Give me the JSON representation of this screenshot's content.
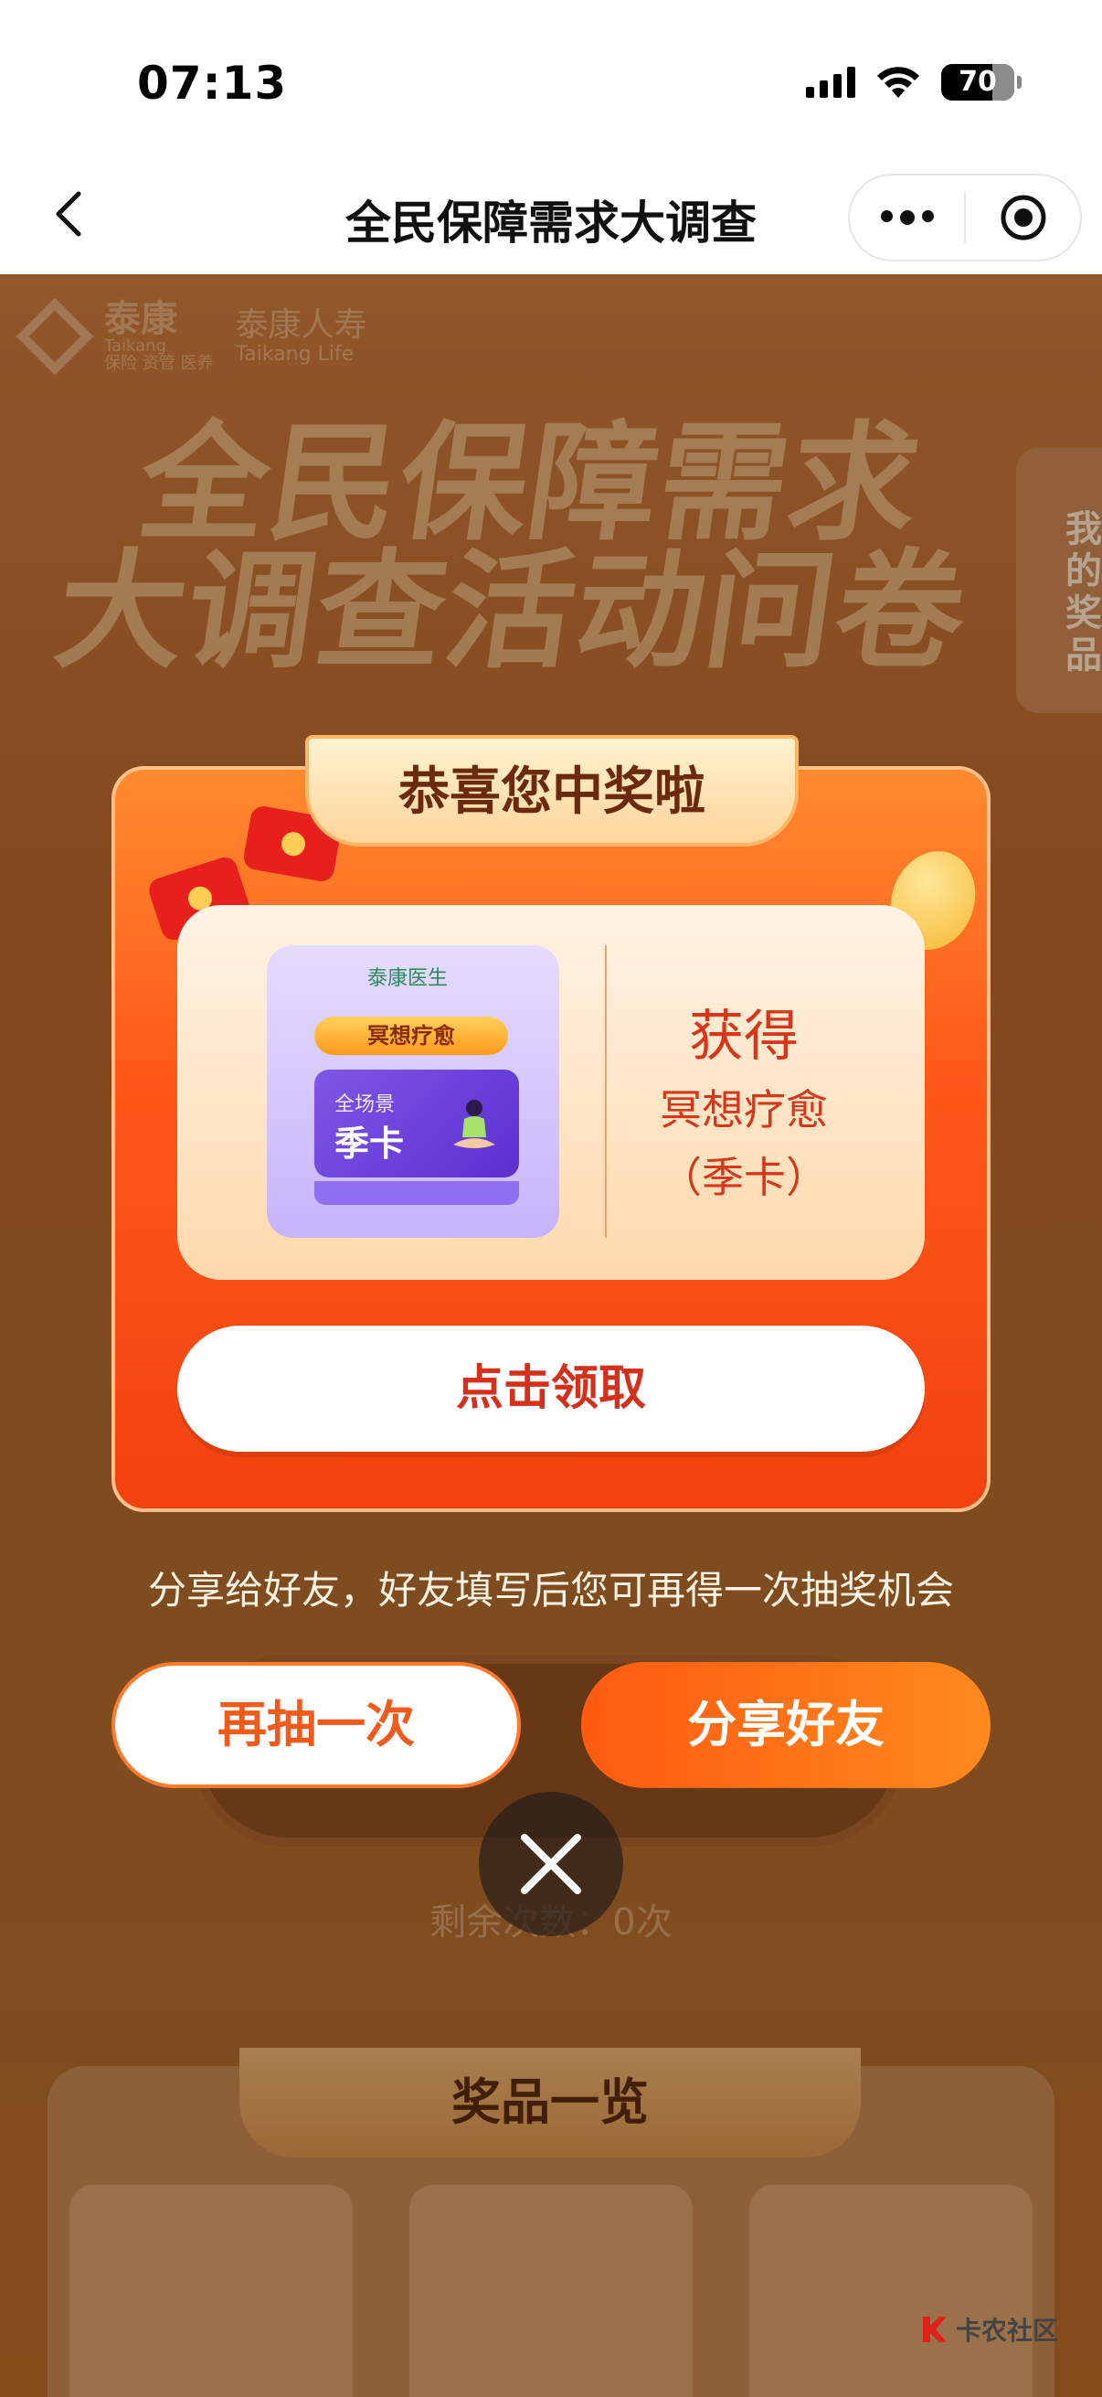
{
  "status_bar": {
    "time": "07:13",
    "battery": "70"
  },
  "nav": {
    "title": "全民保障需求大调查"
  },
  "background": {
    "logo_brand": "泰康",
    "logo_brand_en": "Taikang",
    "logo_slogan": "保险 资管 医养",
    "logo_life_cn": "泰康人寿",
    "logo_life_en": "Taikang Life",
    "hero_line1": "全民保障需求",
    "hero_line2": "大调查活动问卷",
    "my_prizes": "我的奖品",
    "remaining": "剩余次数：0次",
    "prize_list_title": "奖品一览"
  },
  "dialog": {
    "title": "恭喜您中奖啦",
    "image": {
      "brand": "泰康医生",
      "pill": "冥想疗愈",
      "card_line1": "全场景",
      "card_line2": "季卡"
    },
    "get_label": "获得",
    "prize_name": "冥想疗愈",
    "prize_period": "（季卡）",
    "claim_button": "点击领取"
  },
  "share_hint": "分享给好友，好友填写后您可再得一次抽奖机会",
  "buttons": {
    "again": "再抽一次",
    "share": "分享好友"
  },
  "watermark": "卡农社区",
  "colors": {
    "accent": "#ff5a1a",
    "claim_text": "#d4301c",
    "gold": "#ffd59a"
  },
  "icons": [
    "back-chevron-icon",
    "more-dots-icon",
    "target-icon",
    "close-icon",
    "signal-icon",
    "wifi-icon",
    "battery-icon"
  ]
}
